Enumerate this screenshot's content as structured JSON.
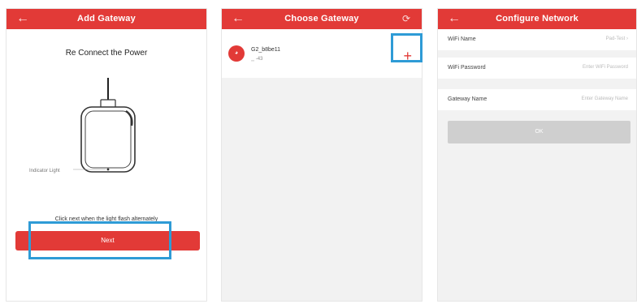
{
  "screen1": {
    "back_icon": "arrow-left-icon",
    "title": "Add Gateway",
    "heading": "Re Connect the Power",
    "indicator_label": "Indicator Light",
    "instruction": "Click next when the light flash alternately",
    "next_label": "Next"
  },
  "screen2": {
    "back_icon": "arrow-left-icon",
    "title": "Choose Gateway",
    "refresh_icon": "refresh-icon",
    "gateway": {
      "name": "G2_b8be11",
      "signal": "-43",
      "icon": "gateway-icon",
      "add_icon": "plus-icon"
    }
  },
  "screen3": {
    "back_icon": "arrow-left-icon",
    "title": "Configure Network",
    "fields": [
      {
        "label": "WiFi Name",
        "value": "Pad-Test"
      },
      {
        "label": "WiFi Password",
        "placeholder": "Enter WiFi Password"
      },
      {
        "label": "Gateway Name",
        "placeholder": "Enter Gateway Name"
      }
    ],
    "ok_label": "OK"
  },
  "colors": {
    "accent": "#e23a37",
    "highlight": "#2e9bd6",
    "disabled_button": "#cfcfcf"
  }
}
